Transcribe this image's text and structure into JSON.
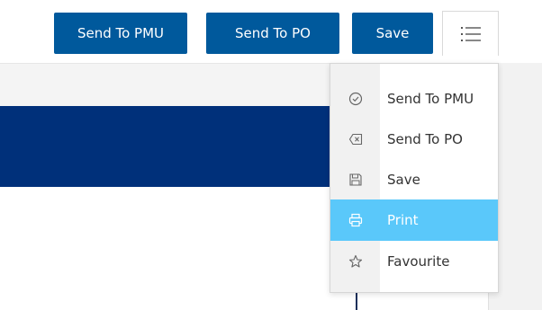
{
  "toolbar": {
    "send_to_pmu_label": "Send To PMU",
    "send_to_po_label": "Send To PO",
    "save_label": "Save",
    "menu_icon": "list-icon"
  },
  "menu": {
    "items": [
      {
        "label": "Send To PMU",
        "icon": "check-circle-icon",
        "active": false
      },
      {
        "label": "Send To PO",
        "icon": "backspace-icon",
        "active": false
      },
      {
        "label": "Save",
        "icon": "floppy-disk-icon",
        "active": false
      },
      {
        "label": "Print",
        "icon": "printer-icon",
        "active": true
      },
      {
        "label": "Favourite",
        "icon": "star-icon",
        "active": false
      }
    ]
  },
  "colors": {
    "primary_button": "#00599c",
    "header_band": "#00307a",
    "menu_highlight": "#5ac8fa",
    "menu_gutter": "#f1f1f1"
  }
}
